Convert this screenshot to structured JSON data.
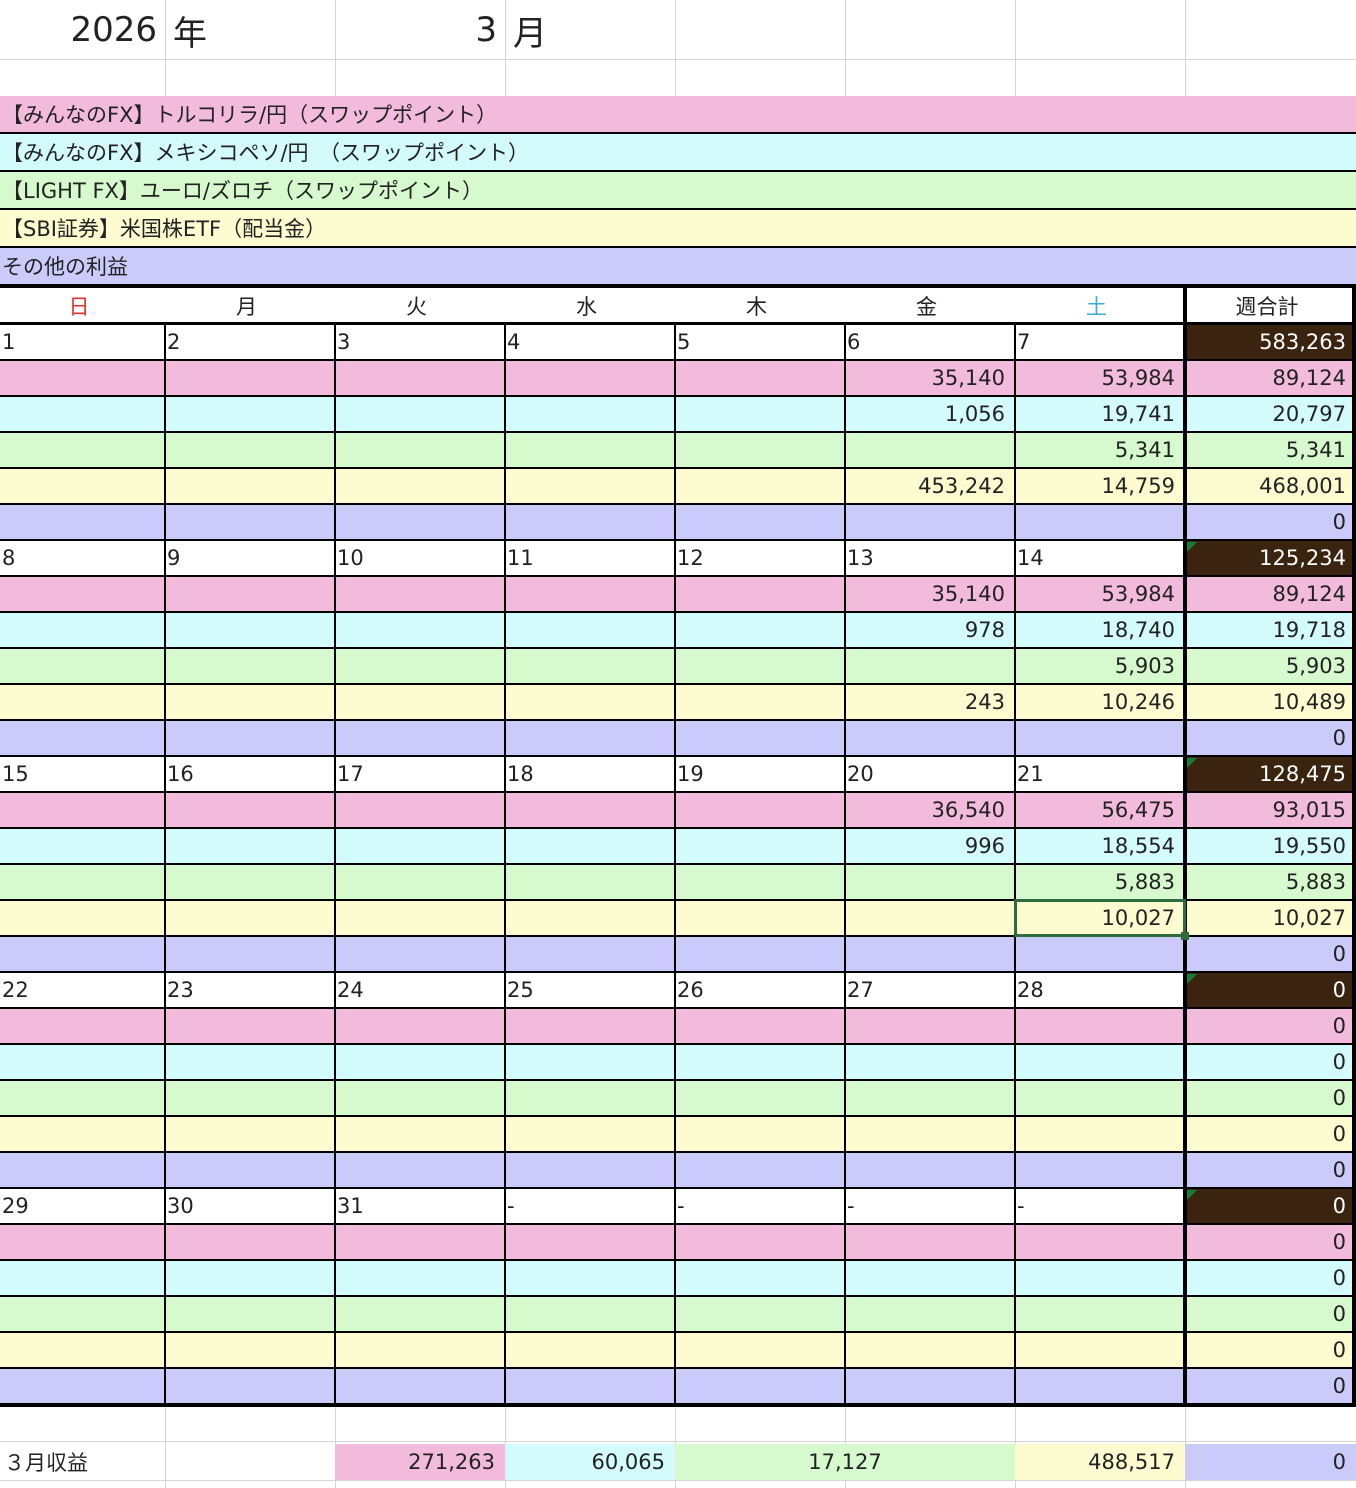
{
  "header": {
    "year": "2026",
    "year_unit": "年",
    "month": "3",
    "month_unit": "月"
  },
  "categories": [
    {
      "label": "【みんなのFX】トルコリラ/円（スワップポイント）",
      "color": "#f2bbdc"
    },
    {
      "label": "【みんなのFX】メキシコペソ/円　（スワップポイント）",
      "color": "#d3fbfb"
    },
    {
      "label": "【LIGHT FX】ユーロ/ズロチ（スワップポイント）",
      "color": "#d6f9cd"
    },
    {
      "label": "【SBI証券】米国株ETF（配当金）",
      "color": "#fdfbd0"
    },
    {
      "label": "その他の利益",
      "color": "#cbcbfb"
    }
  ],
  "weekday_headers": [
    {
      "label": "日",
      "color": "#e0302e"
    },
    {
      "label": "月",
      "color": "#222222"
    },
    {
      "label": "火",
      "color": "#222222"
    },
    {
      "label": "水",
      "color": "#222222"
    },
    {
      "label": "木",
      "color": "#222222"
    },
    {
      "label": "金",
      "color": "#222222"
    },
    {
      "label": "土",
      "color": "#3aa8d8"
    }
  ],
  "weekly_total_header": "週合計",
  "weeks": [
    {
      "days": [
        "1",
        "2",
        "3",
        "4",
        "5",
        "6",
        "7"
      ],
      "total": "583,263",
      "rows": [
        {
          "values": [
            "",
            "",
            "",
            "",
            "",
            "35,140",
            "53,984"
          ],
          "total": "89,124"
        },
        {
          "values": [
            "",
            "",
            "",
            "",
            "",
            "1,056",
            "19,741"
          ],
          "total": "20,797"
        },
        {
          "values": [
            "",
            "",
            "",
            "",
            "",
            "",
            "5,341"
          ],
          "total": "5,341"
        },
        {
          "values": [
            "",
            "",
            "",
            "",
            "",
            "453,242",
            "14,759"
          ],
          "total": "468,001"
        },
        {
          "values": [
            "",
            "",
            "",
            "",
            "",
            "",
            ""
          ],
          "total": "0"
        }
      ]
    },
    {
      "days": [
        "8",
        "9",
        "10",
        "11",
        "12",
        "13",
        "14"
      ],
      "total": "125,234",
      "rows": [
        {
          "values": [
            "",
            "",
            "",
            "",
            "",
            "35,140",
            "53,984"
          ],
          "total": "89,124"
        },
        {
          "values": [
            "",
            "",
            "",
            "",
            "",
            "978",
            "18,740"
          ],
          "total": "19,718"
        },
        {
          "values": [
            "",
            "",
            "",
            "",
            "",
            "",
            "5,903"
          ],
          "total": "5,903"
        },
        {
          "values": [
            "",
            "",
            "",
            "",
            "",
            "243",
            "10,246"
          ],
          "total": "10,489"
        },
        {
          "values": [
            "",
            "",
            "",
            "",
            "",
            "",
            ""
          ],
          "total": "0"
        }
      ]
    },
    {
      "days": [
        "15",
        "16",
        "17",
        "18",
        "19",
        "20",
        "21"
      ],
      "total": "128,475",
      "rows": [
        {
          "values": [
            "",
            "",
            "",
            "",
            "",
            "36,540",
            "56,475"
          ],
          "total": "93,015"
        },
        {
          "values": [
            "",
            "",
            "",
            "",
            "",
            "996",
            "18,554"
          ],
          "total": "19,550"
        },
        {
          "values": [
            "",
            "",
            "",
            "",
            "",
            "",
            "5,883"
          ],
          "total": "5,883"
        },
        {
          "values": [
            "",
            "",
            "",
            "",
            "",
            "",
            "10,027"
          ],
          "total": "10,027"
        },
        {
          "values": [
            "",
            "",
            "",
            "",
            "",
            "",
            ""
          ],
          "total": "0"
        }
      ]
    },
    {
      "days": [
        "22",
        "23",
        "24",
        "25",
        "26",
        "27",
        "28"
      ],
      "total": "0",
      "rows": [
        {
          "values": [
            "",
            "",
            "",
            "",
            "",
            "",
            ""
          ],
          "total": "0"
        },
        {
          "values": [
            "",
            "",
            "",
            "",
            "",
            "",
            ""
          ],
          "total": "0"
        },
        {
          "values": [
            "",
            "",
            "",
            "",
            "",
            "",
            ""
          ],
          "total": "0"
        },
        {
          "values": [
            "",
            "",
            "",
            "",
            "",
            "",
            ""
          ],
          "total": "0"
        },
        {
          "values": [
            "",
            "",
            "",
            "",
            "",
            "",
            ""
          ],
          "total": "0"
        }
      ]
    },
    {
      "days": [
        "29",
        "30",
        "31",
        "-",
        "-",
        "-",
        "-"
      ],
      "total": "0",
      "rows": [
        {
          "values": [
            "",
            "",
            "",
            "",
            "",
            "",
            ""
          ],
          "total": "0"
        },
        {
          "values": [
            "",
            "",
            "",
            "",
            "",
            "",
            ""
          ],
          "total": "0"
        },
        {
          "values": [
            "",
            "",
            "",
            "",
            "",
            "",
            ""
          ],
          "total": "0"
        },
        {
          "values": [
            "",
            "",
            "",
            "",
            "",
            "",
            ""
          ],
          "total": "0"
        },
        {
          "values": [
            "",
            "",
            "",
            "",
            "",
            "",
            ""
          ],
          "total": "0"
        }
      ]
    }
  ],
  "summary": {
    "label": "３月収益",
    "values": [
      "271,263",
      "60,065",
      "17,127",
      "488,517",
      "0"
    ]
  },
  "colors": {
    "week_total_bg": "#3a2410",
    "selection": "#2f6b3d"
  }
}
